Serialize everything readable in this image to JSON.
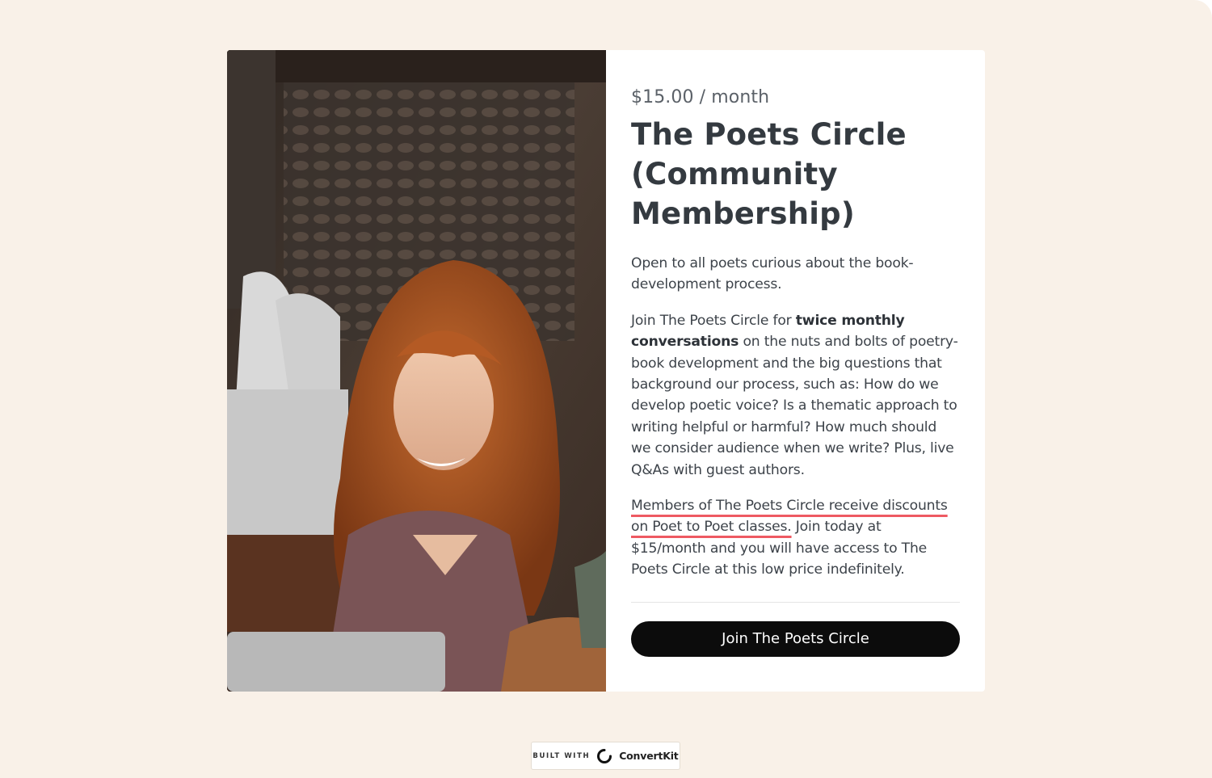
{
  "product": {
    "price": "$15.00 / month",
    "title": "The Poets Circle (Community Membership)",
    "para1": "Open to all poets curious about the book-development process.",
    "para2_prefix": "Join The Poets Circle for ",
    "para2_bold": "twice monthly conversations",
    "para2_suffix": " on the nuts and bolts of poetry-book development and the big questions that background our process, such as: How do we develop poetic voice? Is a thematic approach to writing helpful or harmful? How much should we consider audience when we write? Plus, live Q&As with guest authors.",
    "para3_highlight": "Members of The Poets Circle receive discounts on Poet to Poet classes.",
    "para3_rest": " Join today at $15/month and you will have access to The Poets Circle at this low price indefinitely.",
    "cta_label": "Join The Poets Circle"
  },
  "footer": {
    "built_with": "BUILT WITH",
    "brand": "ConvertKit"
  },
  "colors": {
    "page_bg": "#f9f1e8",
    "accent_underline": "#ee5a62",
    "button": "#0c0c0c"
  }
}
